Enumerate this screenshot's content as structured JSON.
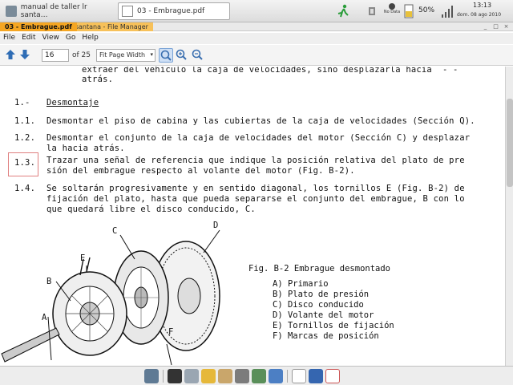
{
  "top_panel": {
    "tasks": [
      {
        "label": "manual de taller lr santa…"
      },
      {
        "label": "03 - Embrague.pdf"
      }
    ],
    "tray": {
      "no_data": "No Data",
      "battery_pct": "50%",
      "time": "13:13",
      "date": "dom. 08 ago 2010"
    }
  },
  "window": {
    "tab_active": "03 - Embrague.pdf",
    "tab_inactive": "r santana - File Manager",
    "controls": [
      "_",
      "□",
      "×"
    ]
  },
  "menu": [
    "File",
    "Edit",
    "View",
    "Go",
    "Help"
  ],
  "toolbar": {
    "page_value": "16",
    "page_total": "of 25",
    "zoom_label": "Fit Page Width",
    "icons": [
      "back-arrow-icon",
      "forward-arrow-icon",
      "zoom-fit-icon",
      "zoom-in-icon",
      "zoom-out-icon"
    ]
  },
  "document": {
    "lines": [
      "extraer del vehículo la caja de velocidades, sino desplazarla hacia  - -",
      "atrás.",
      "1.-",
      "Desmontaje",
      "1.1.",
      "Desmontar el piso de cabina y las cubiertas de la caja de velocidades (Sección Q).",
      "1.2.",
      "Desmontar el conjunto de la caja de velocidades del motor (Sección C) y desplazar",
      "la hacia atrás.",
      "1.3.",
      "Trazar una señal de referencia que indique la posición relativa del plato de pre",
      "sión del embrague respecto al volante del motor (Fig. B-2).",
      "1.4.",
      "Se soltarán progresivamente y en sentido diagonal, los tornillos E (Fig. B-2) de",
      "fijación del plato, hasta que pueda separarse el conjunto del embrague, B con lo",
      "que quedará libre el disco conducido, C."
    ],
    "figure": {
      "labels": [
        "A",
        "B",
        "C",
        "D",
        "E",
        "F"
      ],
      "caption": "Fig. B-2 Embrague desmontado",
      "legend": [
        "A) Primario",
        "B) Plato de presión",
        "C) Disco conducido",
        "D) Volante del motor",
        "E) Tornillos de fijación",
        "F) Marcas de posición"
      ]
    }
  },
  "taskbar": {
    "icons": [
      "tools-icon",
      "terminal-icon",
      "mail-icon",
      "folder-icon",
      "clipboard-icon",
      "calculator-icon",
      "photo-icon",
      "globe-icon",
      "pdf-icon",
      "window-icon",
      "document-icon"
    ]
  }
}
